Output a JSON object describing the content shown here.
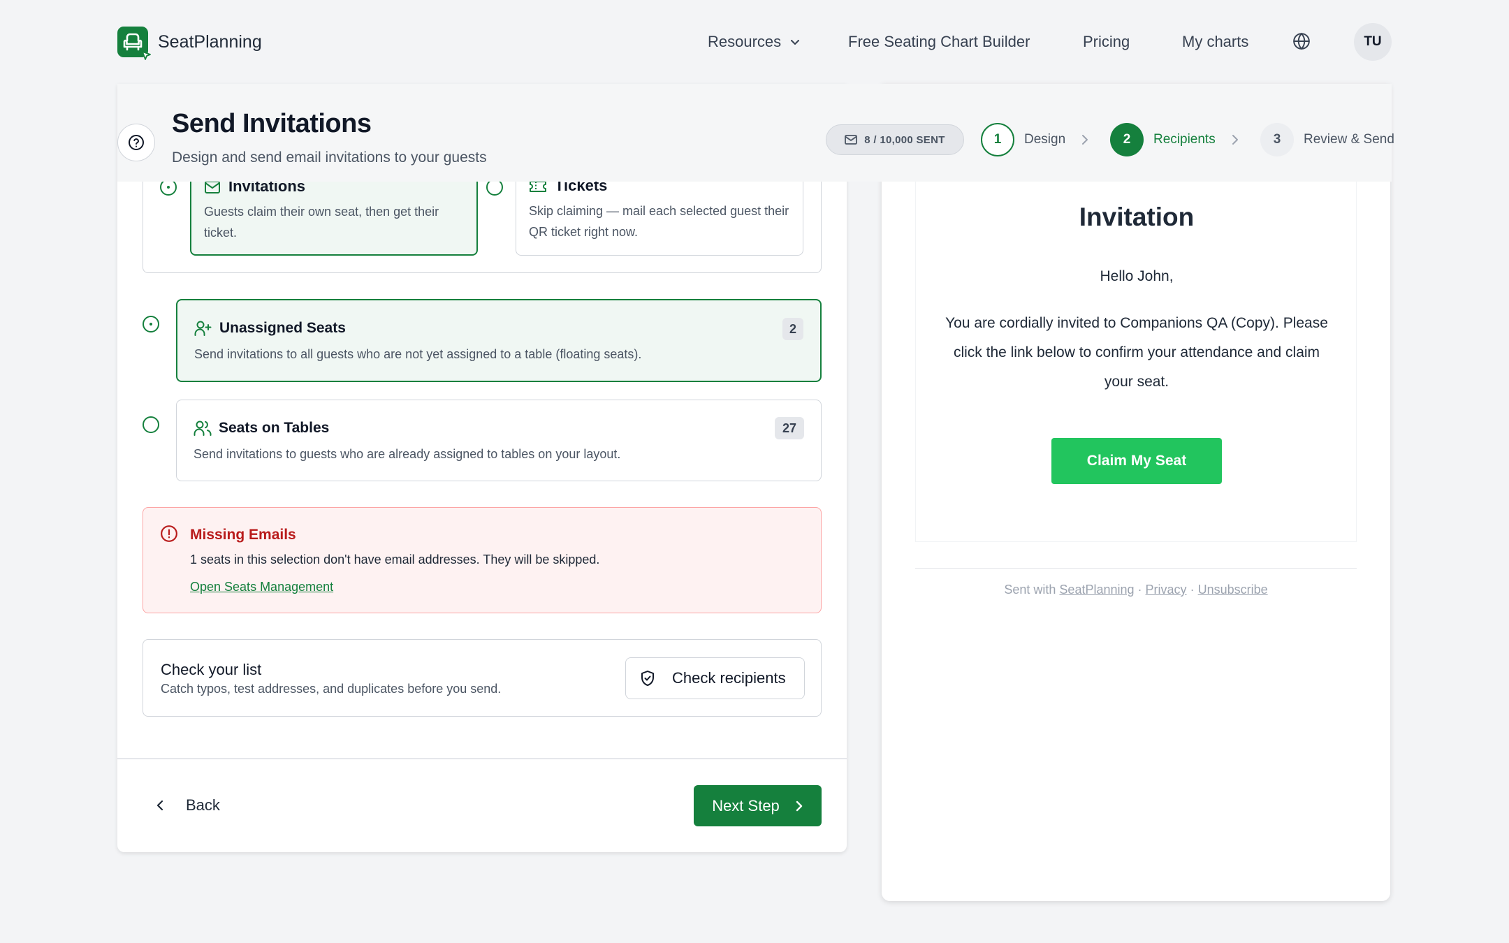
{
  "brand": {
    "name": "SeatPlanning"
  },
  "nav": {
    "resources": "Resources",
    "free_builder": "Free Seating Chart Builder",
    "pricing": "Pricing",
    "my_charts": "My charts",
    "avatar_initials": "TU"
  },
  "header": {
    "title": "Send Invitations",
    "subtitle": "Design and send email invitations to your guests",
    "sent_badge": "8 / 10,000 SENT",
    "steps": [
      {
        "number": "1",
        "label": "Design",
        "state": "completed"
      },
      {
        "number": "2",
        "label": "Recipients",
        "state": "active"
      },
      {
        "number": "3",
        "label": "Review & Send",
        "state": "upcoming"
      }
    ]
  },
  "send_mode": {
    "invitations": {
      "title": "Invitations",
      "description": "Guests claim their own seat, then get their ticket.",
      "selected": true
    },
    "tickets": {
      "title": "Tickets",
      "description": "Skip claiming — mail each selected guest their QR ticket right now.",
      "selected": false
    }
  },
  "recipient_options": [
    {
      "title": "Unassigned Seats",
      "description": "Send invitations to all guests who are not yet assigned to a table (floating seats).",
      "count": "2",
      "selected": true
    },
    {
      "title": "Seats on Tables",
      "description": "Send invitations to guests who are already assigned to tables on your layout.",
      "count": "27",
      "selected": false
    }
  ],
  "missing_emails": {
    "title": "Missing Emails",
    "text": "1 seats in this selection don't have email addresses. They will be skipped.",
    "link": "Open Seats Management"
  },
  "check_list": {
    "title": "Check your list",
    "subtitle": "Catch typos, test addresses, and duplicates before you send.",
    "button": "Check recipients"
  },
  "footer_actions": {
    "back": "Back",
    "next": "Next Step"
  },
  "preview": {
    "title": "Invitation",
    "greeting": "Hello John,",
    "body": "You are cordially invited to Companions QA (Copy). Please click the link below to confirm your attendance and claim your seat.",
    "button": "Claim My Seat",
    "footer_prefix": "Sent with",
    "footer_brand": "SeatPlanning",
    "footer_privacy": "Privacy",
    "footer_unsubscribe": "Unsubscribe",
    "separator": "·"
  },
  "colors": {
    "brand_green": "#15803d",
    "cta_green": "#22c55e",
    "alert_red": "#b91c1c",
    "selected_bg": "#f0f7f3"
  },
  "icons": [
    "seat-logo-icon",
    "cursor-icon",
    "chevron-down-icon",
    "globe-icon",
    "help-icon",
    "mail-icon",
    "ticket-icon",
    "user-plus-icon",
    "users-icon",
    "alert-circle-icon",
    "shield-check-icon",
    "chevron-left-icon",
    "chevron-right-icon"
  ]
}
